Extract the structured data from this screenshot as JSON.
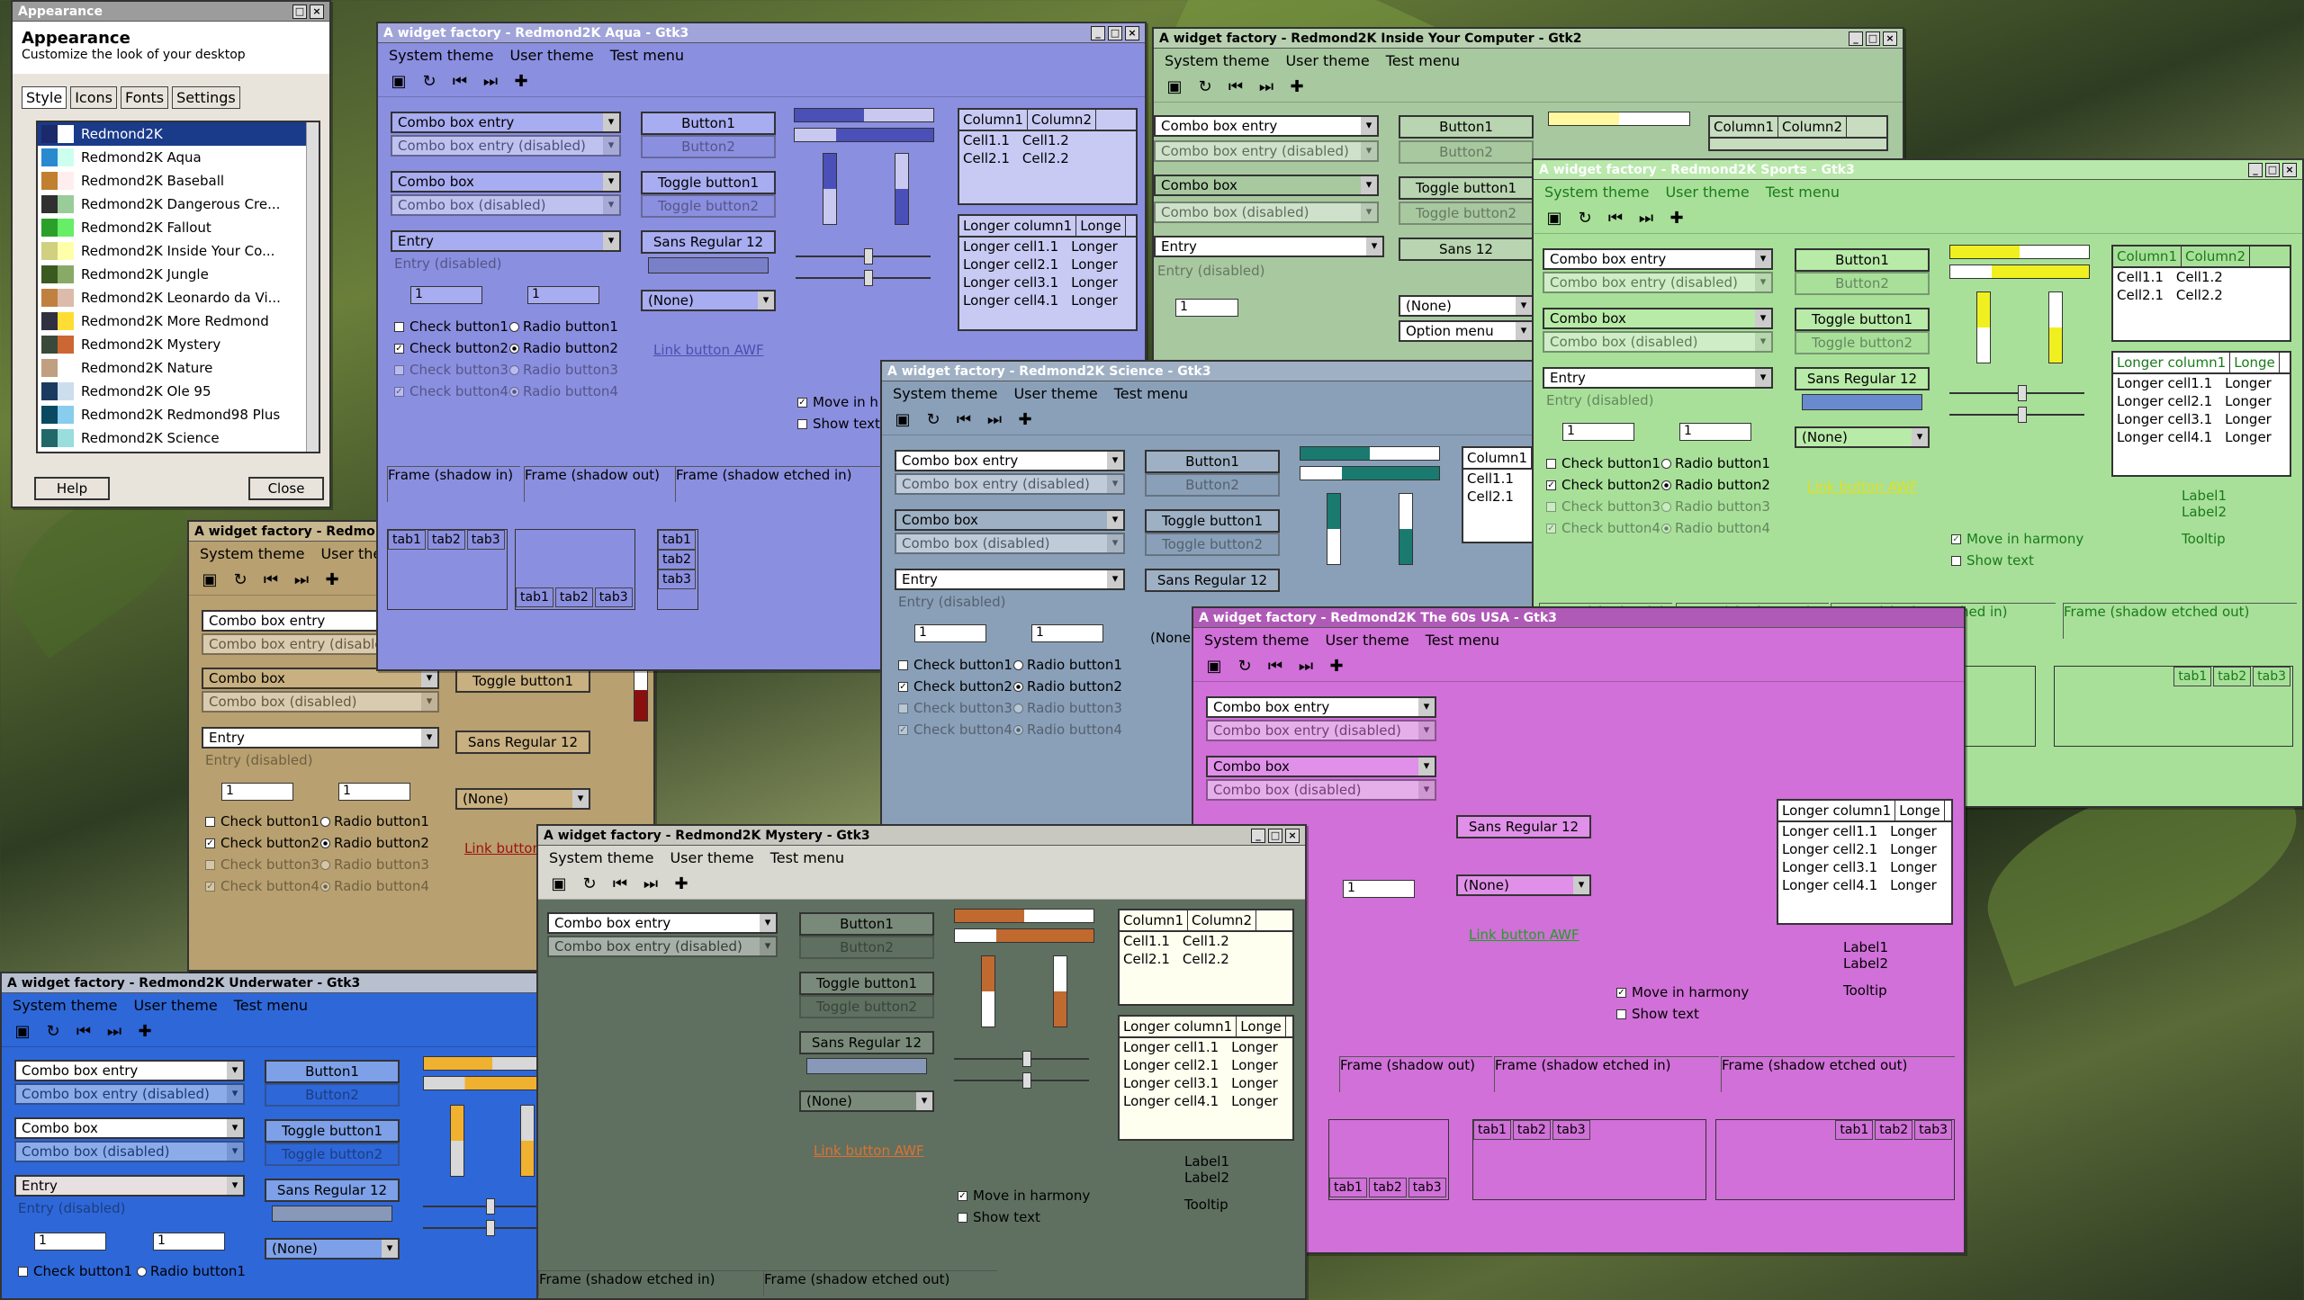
{
  "appearance": {
    "title": "Appearance",
    "heading": "Appearance",
    "subheading": "Customize the look of your desktop",
    "tabs": [
      "Style",
      "Icons",
      "Fonts",
      "Settings"
    ],
    "themes": [
      "Redmond2K",
      "Redmond2K Aqua",
      "Redmond2K Baseball",
      "Redmond2K Dangerous Cre...",
      "Redmond2K Fallout",
      "Redmond2K Inside Your Co...",
      "Redmond2K Jungle",
      "Redmond2K Leonardo da Vi...",
      "Redmond2K More Redmond",
      "Redmond2K Mystery",
      "Redmond2K Nature",
      "Redmond2K Ole 95",
      "Redmond2K Redmond98 Plus",
      "Redmond2K Science"
    ],
    "help": "Help",
    "close": "Close"
  },
  "common": {
    "system_theme": "System theme",
    "user_theme": "User theme",
    "test_menu": "Test menu",
    "combo_entry": "Combo box entry",
    "combo_entry_dis": "Combo box entry (disabled)",
    "combo": "Combo box",
    "combo_dis": "Combo box (disabled)",
    "entry": "Entry",
    "entry_dis": "Entry (disabled)",
    "button1": "Button1",
    "button2": "Button2",
    "toggle1": "Toggle button1",
    "toggle2": "Toggle button2",
    "font": "Sans Regular",
    "font_size": "12",
    "none": "(None)",
    "spin": "1",
    "link": "Link button AWF",
    "check1": "Check button1",
    "check2": "Check button2",
    "check3": "Check button3",
    "check4": "Check button4",
    "radio1": "Radio button1",
    "radio2": "Radio button2",
    "radio3": "Radio button3",
    "radio4": "Radio button4",
    "frame_in": "Frame (shadow in)",
    "frame_out": "Frame (shadow out)",
    "frame_etched": "Frame (shadow etched in)",
    "frame_etched_out": "Frame (shadow etched out)",
    "tab1": "tab1",
    "tab2": "tab2",
    "tab3": "tab3",
    "col1": "Column1",
    "col2": "Column2",
    "longer_col": "Longer column1",
    "longe": "Longe",
    "cell11": "Cell1.1",
    "cell12": "Cell1.2",
    "cell21": "Cell2.1",
    "cell22": "Cell2.2",
    "lcell1": "Longer cell1.1",
    "lcell2": "Longer cell2.1",
    "lcell3": "Longer cell3.1",
    "lcell4": "Longer cell4.1",
    "longer": "Longer",
    "move": "Move in harmony",
    "show": "Show text",
    "label1": "Label1",
    "label2": "Label2",
    "tooltip": "Tooltip",
    "option_menu": "Option menu",
    "sans": "Sans",
    "move_h": "Move in h",
    "show_t": "Show text"
  },
  "windows": {
    "aqua": "A widget factory - Redmond2K Aqua - Gtk3",
    "inside": "A widget factory - Redmond2K Inside Your Computer - Gtk2",
    "sports": "A widget factory - Redmond2K Sports - Gtk3",
    "science": "A widget factory - Redmond2K Science - Gtk3",
    "sixties": "A widget factory - Redmond2K The 60s USA - Gtk3",
    "mystery": "A widget factory - Redmond2K Mystery - Gtk3",
    "underwater": "A widget factory - Redmond2K Underwater - Gtk3",
    "beige": "A widget factory - Redmo"
  },
  "colors": {
    "aqua": "#8b8fe0",
    "inside": "#a8c8a0",
    "sports": "#a8e09a",
    "science": "#8aa0b8",
    "sixties": "#d070d8",
    "mystery": "#5f7060",
    "underwater": "#2e67d8",
    "beige": "#b8a070",
    "appearance": "#e8e4dc"
  }
}
